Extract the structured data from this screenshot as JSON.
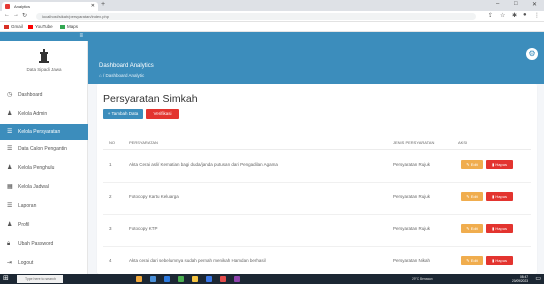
{
  "browser": {
    "tab_title": "Analytics",
    "url": "localhost/sikah/persyaratan/index.php",
    "bookmarks": [
      "Gmail",
      "YouTube",
      "Maps"
    ]
  },
  "sidebar": {
    "app_name": "Data Sipadi Jawa",
    "items": [
      {
        "icon": "dashboard-icon",
        "label": "Dashboard"
      },
      {
        "icon": "user-icon",
        "label": "Kelola Admin"
      },
      {
        "icon": "list-icon",
        "label": "Kelola Persyaratan"
      },
      {
        "icon": "list-icon",
        "label": "Data Calon Pengantin"
      },
      {
        "icon": "user-icon",
        "label": "Kelola Penghulu"
      },
      {
        "icon": "calendar-icon",
        "label": "Kelola Jadwal"
      },
      {
        "icon": "list-icon",
        "label": "Laporan"
      },
      {
        "icon": "user-icon",
        "label": "Profil"
      },
      {
        "icon": "lock-icon",
        "label": "Ubah Password"
      },
      {
        "icon": "logout-icon",
        "label": "Logout"
      }
    ],
    "active_index": 2
  },
  "header": {
    "title": "Dashboard Analytics",
    "breadcrumb": "Dashboard Analytic"
  },
  "main": {
    "title": "Persyaratan Simkah",
    "add_button": "+ Tambah Data",
    "verify_button": "Verifikasi",
    "columns": [
      "NO",
      "PERSYARATAN",
      "JENIS PERSYARATAN",
      "AKSI"
    ],
    "rows": [
      {
        "no": "1",
        "persyaratan": "Akta Cerai asli/ Kematian bagi duda/janda putusan dari Pengadilan Agama",
        "jenis": "Persyaratan Rujuk"
      },
      {
        "no": "2",
        "persyaratan": "Fotocopy Kartu Keluarga",
        "jenis": "Persyaratan Rujuk"
      },
      {
        "no": "3",
        "persyaratan": "Fotocopy KTP",
        "jenis": "Persyaratan Rujuk"
      },
      {
        "no": "4",
        "persyaratan": "Akta cerai dari sebelumnya sudah pernah menikah Hamdan berhasil",
        "jenis": "Persyaratan Nikah"
      }
    ],
    "edit_label": "Edit",
    "delete_label": "Hapus"
  },
  "taskbar": {
    "search_placeholder": "Type here to search",
    "tray_text": "29°C Berawan",
    "time": "08:47",
    "date": "20/09/2023"
  },
  "colors": {
    "primary": "#3c8dbc",
    "danger": "#e3342f",
    "warning": "#f0ad4e"
  }
}
